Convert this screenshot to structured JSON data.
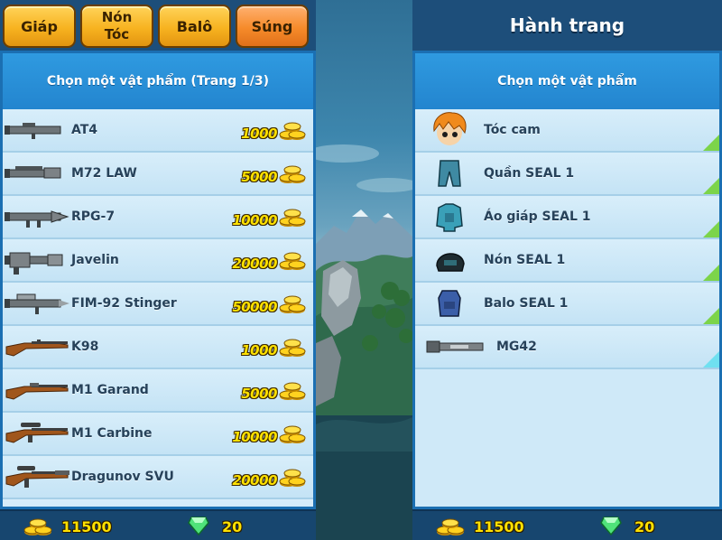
{
  "tabs": [
    {
      "label": "Giáp",
      "active": false
    },
    {
      "label": "Nón\nTóc",
      "active": false
    },
    {
      "label": "Balô",
      "active": false
    },
    {
      "label": "Súng",
      "active": true
    }
  ],
  "shop": {
    "title": "Chọn một vật phẩm (Trang 1/3)",
    "items": [
      {
        "name": "AT4",
        "price": "1000",
        "icon": "at4-launcher-icon"
      },
      {
        "name": "M72 LAW",
        "price": "5000",
        "icon": "m72-law-launcher-icon"
      },
      {
        "name": "RPG-7",
        "price": "10000",
        "icon": "rpg7-launcher-icon"
      },
      {
        "name": "Javelin",
        "price": "20000",
        "icon": "javelin-launcher-icon"
      },
      {
        "name": "FIM-92 Stinger",
        "price": "50000",
        "icon": "stinger-launcher-icon"
      },
      {
        "name": "K98",
        "price": "1000",
        "icon": "k98-rifle-icon"
      },
      {
        "name": "M1 Garand",
        "price": "5000",
        "icon": "m1-garand-rifle-icon"
      },
      {
        "name": "M1 Carbine",
        "price": "10000",
        "icon": "m1-carbine-rifle-icon"
      },
      {
        "name": "Dragunov SVU",
        "price": "20000",
        "icon": "dragunov-rifle-icon"
      }
    ]
  },
  "inventory": {
    "header": "Hành trang",
    "title": "Chọn một vật phẩm",
    "items": [
      {
        "name": "Tóc cam",
        "icon": "orange-hair-icon"
      },
      {
        "name": "Quần SEAL 1",
        "icon": "seal-pants-icon"
      },
      {
        "name": "Áo giáp SEAL 1",
        "icon": "seal-armor-icon"
      },
      {
        "name": "Nón SEAL 1",
        "icon": "seal-helmet-icon"
      },
      {
        "name": "Balo SEAL 1",
        "icon": "seal-backpack-icon"
      },
      {
        "name": "MG42",
        "icon": "mg42-gun-icon"
      }
    ]
  },
  "wallet": {
    "gold": "11500",
    "gems": "20"
  },
  "colors": {
    "tab_active": "#f68b2a",
    "tab": "#f7b320",
    "panel": "#2a8fd6",
    "price": "#ffe100"
  }
}
